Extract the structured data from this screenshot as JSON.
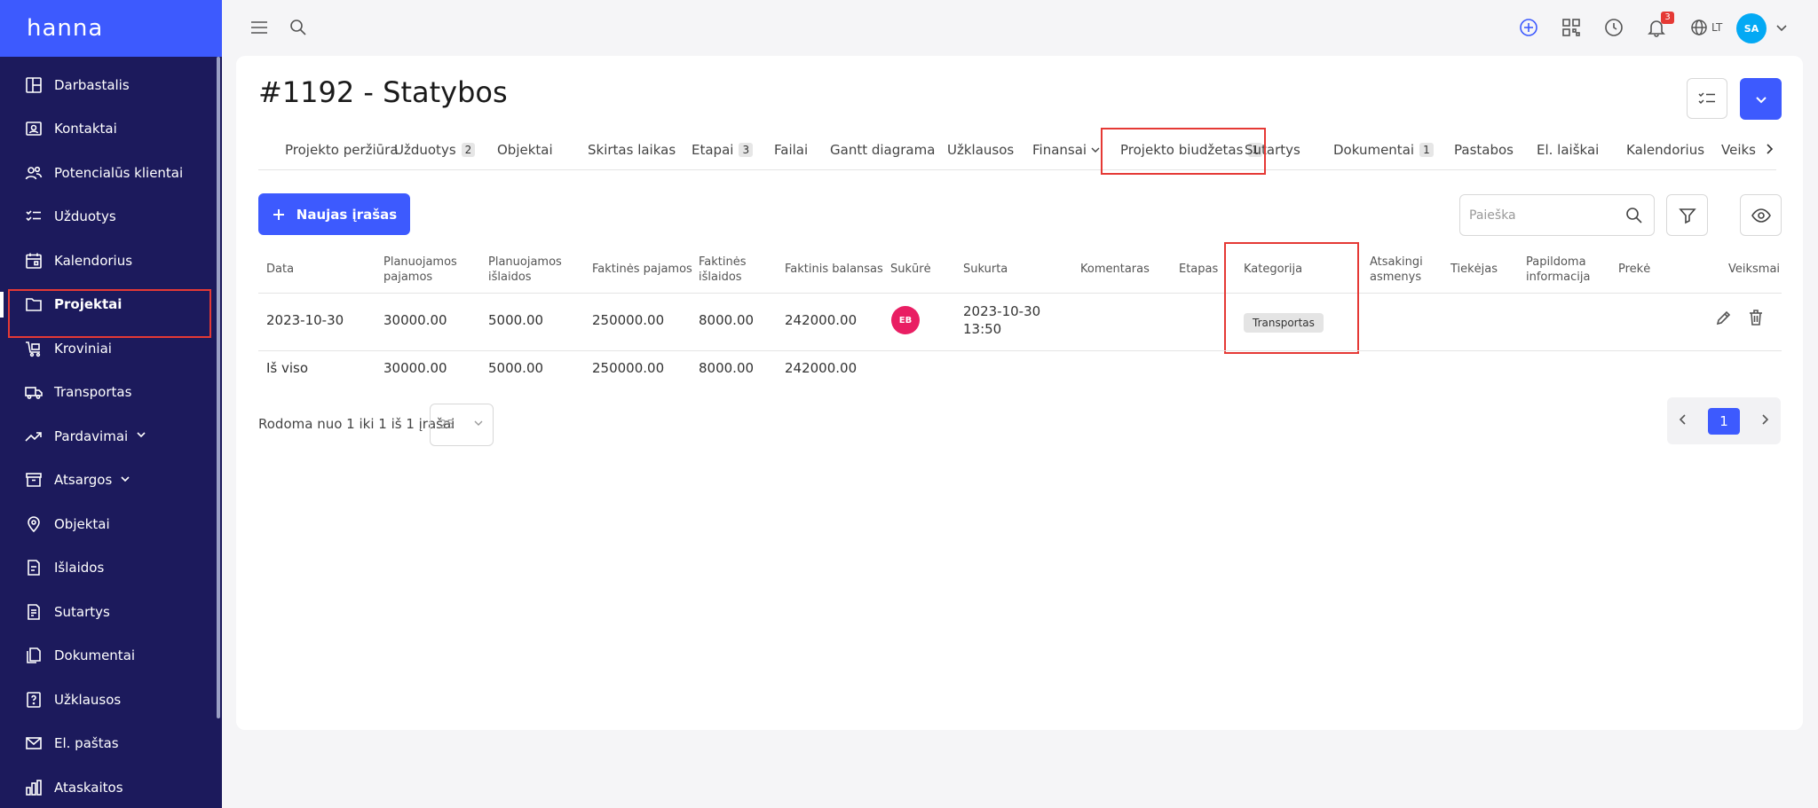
{
  "app": {
    "logo": "hanna"
  },
  "sidebar": {
    "items": [
      {
        "label": "Darbastalis",
        "icon": "dashboard-icon"
      },
      {
        "label": "Kontaktai",
        "icon": "contacts-icon"
      },
      {
        "label": "Potencialūs klientai",
        "icon": "leads-icon"
      },
      {
        "label": "Užduotys",
        "icon": "tasks-icon"
      },
      {
        "label": "Kalendorius",
        "icon": "calendar-icon"
      },
      {
        "label": "Projektai",
        "icon": "folder-icon",
        "active": true
      },
      {
        "label": "Kroviniai",
        "icon": "cargo-icon"
      },
      {
        "label": "Transportas",
        "icon": "truck-icon"
      },
      {
        "label": "Pardavimai",
        "icon": "sales-icon",
        "expandable": true
      },
      {
        "label": "Atsargos",
        "icon": "stock-icon",
        "expandable": true
      },
      {
        "label": "Objektai",
        "icon": "location-icon"
      },
      {
        "label": "Išlaidos",
        "icon": "expenses-icon"
      },
      {
        "label": "Sutartys",
        "icon": "contracts-icon"
      },
      {
        "label": "Dokumentai",
        "icon": "documents-icon"
      },
      {
        "label": "Užklausos",
        "icon": "inquiries-icon"
      },
      {
        "label": "El. paštas",
        "icon": "mail-icon"
      },
      {
        "label": "Ataskaitos",
        "icon": "reports-icon"
      }
    ]
  },
  "topbar": {
    "notifications_count": "3",
    "language": "LT",
    "user_initials": "SA"
  },
  "page": {
    "title": "#1192 - Statybos"
  },
  "tabs": [
    {
      "label": "Projekto peržiūra"
    },
    {
      "label": "Užduotys",
      "count": "2"
    },
    {
      "label": "Objektai"
    },
    {
      "label": "Skirtas laikas"
    },
    {
      "label": "Etapai",
      "count": "3"
    },
    {
      "label": "Failai"
    },
    {
      "label": "Gantt diagrama"
    },
    {
      "label": "Užklausos"
    },
    {
      "label": "Finansai",
      "dropdown": true
    },
    {
      "label": "Projekto biudžetas",
      "count": "1",
      "active": true
    },
    {
      "label": "Sutartys"
    },
    {
      "label": "Dokumentai",
      "count": "1"
    },
    {
      "label": "Pastabos"
    },
    {
      "label": "El. laiškai"
    },
    {
      "label": "Kalendorius"
    },
    {
      "label": "Veiks"
    }
  ],
  "toolbar": {
    "new_label": "Naujas įrašas",
    "search_placeholder": "Paieška"
  },
  "table": {
    "columns": [
      "Data",
      "Planuojamos pajamos",
      "Planuojamos išlaidos",
      "Faktinės pajamos",
      "Faktinės išlaidos",
      "Faktinis balansas",
      "Sukūrė",
      "Sukurta",
      "Komentaras",
      "Etapas",
      "Kategorija",
      "Atsakingi asmenys",
      "Tiekėjas",
      "Papildoma informacija",
      "Prekė",
      "Veiksmai"
    ],
    "rows": [
      {
        "date": "2023-10-30",
        "planned_income": "30000.00",
        "planned_expenses": "5000.00",
        "actual_income": "250000.00",
        "actual_expenses": "8000.00",
        "actual_balance": "242000.00",
        "created_by": "EB",
        "created_at_date": "2023-10-30",
        "created_at_time": "13:50",
        "category": "Transportas"
      }
    ],
    "totals": {
      "label": "Iš viso",
      "planned_income": "30000.00",
      "planned_expenses": "5000.00",
      "actual_income": "250000.00",
      "actual_expenses": "8000.00",
      "actual_balance": "242000.00"
    }
  },
  "pagination": {
    "info": "Rodoma nuo 1 iki 1 iš 1 įrašai",
    "page_size": "25",
    "current_page": "1"
  },
  "colors": {
    "primary": "#3d5afe",
    "sidebar": "#1c1a5c",
    "highlight": "#e53935",
    "avatar_sa": "#03a9f4",
    "avatar_eb": "#e91e63"
  }
}
